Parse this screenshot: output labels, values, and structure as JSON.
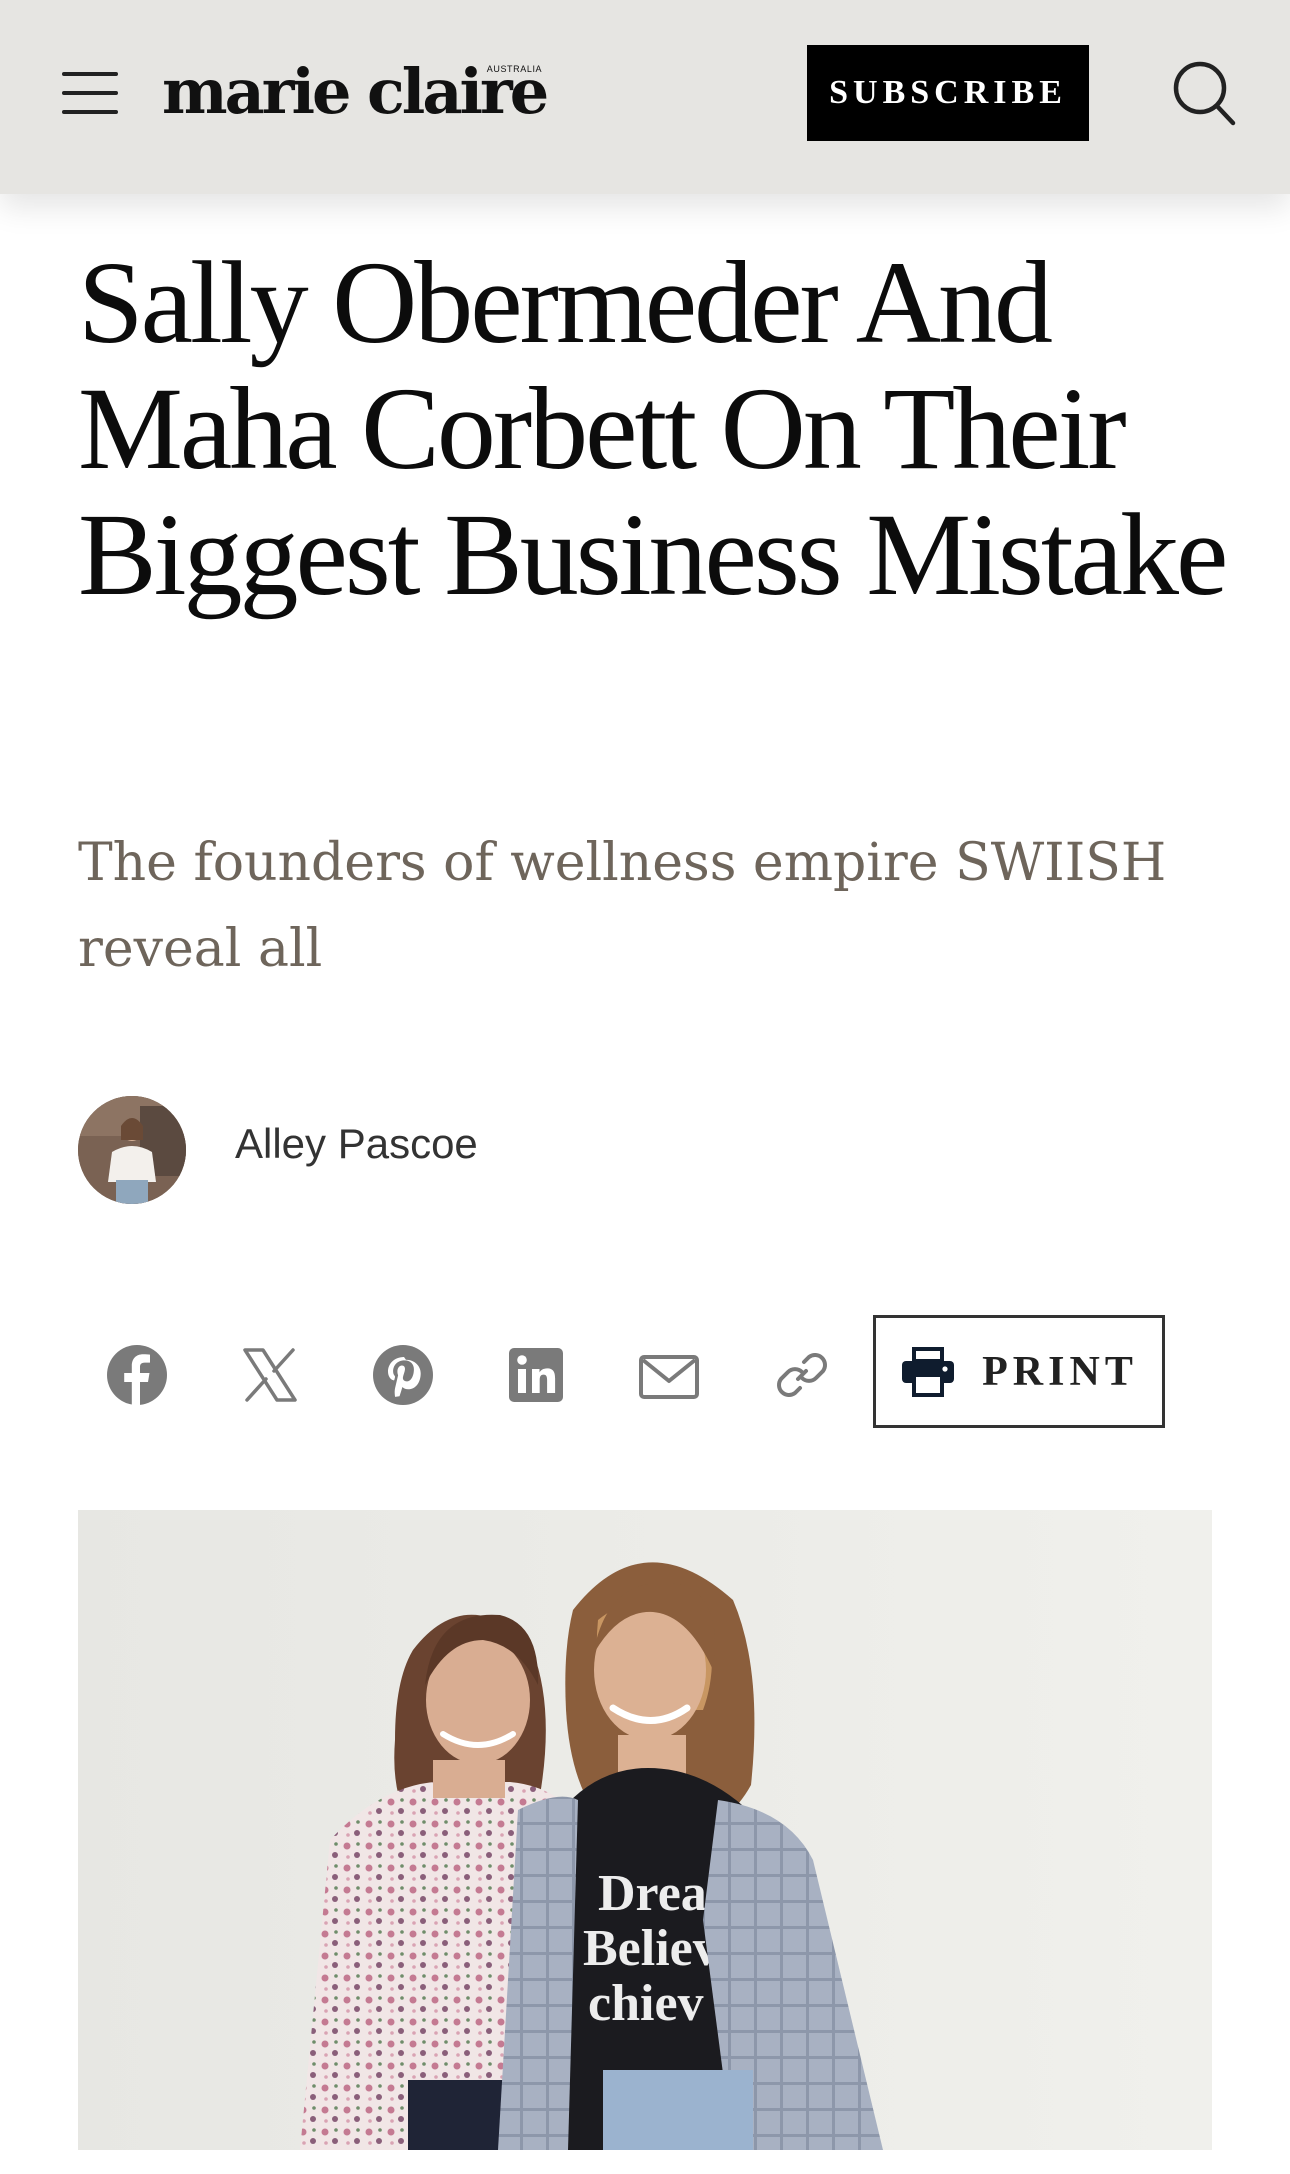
{
  "header": {
    "logo_text": "marie claire",
    "logo_edition": "AUSTRALIA",
    "subscribe_label": "SUBSCRIBE",
    "menu_icon": "hamburger-menu-icon",
    "search_icon": "search-icon",
    "background_color": "#e6e5e2"
  },
  "article": {
    "headline": "Sally Obermeder And Maha Corbett On Their Biggest Business Mistake",
    "standfirst": "The founders of wellness empire SWIISH reveal all",
    "author": {
      "name": "Alley Pascoe",
      "avatar_icon": "author-avatar"
    },
    "share": {
      "icons": [
        "facebook-icon",
        "x-icon",
        "pinterest-icon",
        "linkedin-icon",
        "email-icon",
        "link-icon"
      ],
      "print_label": "PRINT",
      "print_icon": "printer-icon",
      "icon_color": "#7a7a7a"
    },
    "hero_image": "two-women-smiling-photo"
  },
  "colors": {
    "headline": "#0c0c0c",
    "standfirst": "#6e655b",
    "subscribe_bg": "#000000"
  }
}
